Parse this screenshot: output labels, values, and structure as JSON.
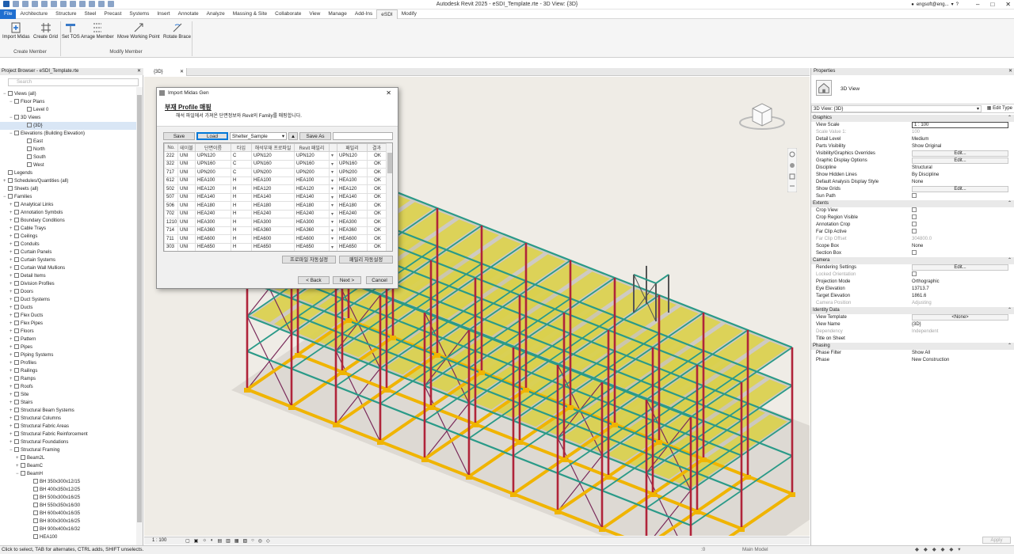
{
  "window": {
    "title": "Autodesk Revit 2025 - eSDI_Template.rte - 3D View: {3D}",
    "user": "engsoft@eng..."
  },
  "tabs": [
    "File",
    "Architecture",
    "Structure",
    "Steel",
    "Precast",
    "Systems",
    "Insert",
    "Annotate",
    "Analyze",
    "Massing & Site",
    "Collaborate",
    "View",
    "Manage",
    "Add-Ins",
    "eSDI",
    "Modify"
  ],
  "active_tab": "eSDI",
  "ribbon": {
    "buttons": [
      "Import Midas",
      "Create Grid",
      "Set TOS",
      "Arrage Member",
      "Move Working Point",
      "Rotate Brace"
    ],
    "panels": [
      "Create Member",
      "Modify Member"
    ]
  },
  "project_browser": {
    "title": "Project Browser - eSDI_Template.rte",
    "search_placeholder": "Search",
    "items": [
      {
        "label": "Views (all)",
        "depth": 0,
        "exp": "−"
      },
      {
        "label": "Floor Plans",
        "depth": 1,
        "exp": "−"
      },
      {
        "label": "Level 0",
        "depth": 3,
        "exp": ""
      },
      {
        "label": "3D Views",
        "depth": 1,
        "exp": "−"
      },
      {
        "label": "{3D}",
        "depth": 3,
        "exp": "",
        "sel": true
      },
      {
        "label": "Elevations (Building Elevation)",
        "depth": 1,
        "exp": "−"
      },
      {
        "label": "East",
        "depth": 3,
        "exp": ""
      },
      {
        "label": "North",
        "depth": 3,
        "exp": ""
      },
      {
        "label": "South",
        "depth": 3,
        "exp": ""
      },
      {
        "label": "West",
        "depth": 3,
        "exp": ""
      },
      {
        "label": "Legends",
        "depth": 0,
        "exp": ""
      },
      {
        "label": "Schedules/Quantities (all)",
        "depth": 0,
        "exp": "+"
      },
      {
        "label": "Sheets (all)",
        "depth": 0,
        "exp": ""
      },
      {
        "label": "Families",
        "depth": 0,
        "exp": "−"
      },
      {
        "label": "Analytical Links",
        "depth": 1,
        "exp": "+"
      },
      {
        "label": "Annotation Symbols",
        "depth": 1,
        "exp": "+"
      },
      {
        "label": "Boundary Conditions",
        "depth": 1,
        "exp": "+"
      },
      {
        "label": "Cable Trays",
        "depth": 1,
        "exp": "+"
      },
      {
        "label": "Ceilings",
        "depth": 1,
        "exp": "+"
      },
      {
        "label": "Conduits",
        "depth": 1,
        "exp": "+"
      },
      {
        "label": "Curtain Panels",
        "depth": 1,
        "exp": "+"
      },
      {
        "label": "Curtain Systems",
        "depth": 1,
        "exp": "+"
      },
      {
        "label": "Curtain Wall Mullions",
        "depth": 1,
        "exp": "+"
      },
      {
        "label": "Detail Items",
        "depth": 1,
        "exp": "+"
      },
      {
        "label": "Division Profiles",
        "depth": 1,
        "exp": "+"
      },
      {
        "label": "Doors",
        "depth": 1,
        "exp": "+"
      },
      {
        "label": "Duct Systems",
        "depth": 1,
        "exp": "+"
      },
      {
        "label": "Ducts",
        "depth": 1,
        "exp": "+"
      },
      {
        "label": "Flex Ducts",
        "depth": 1,
        "exp": "+"
      },
      {
        "label": "Flex Pipes",
        "depth": 1,
        "exp": "+"
      },
      {
        "label": "Floors",
        "depth": 1,
        "exp": "+"
      },
      {
        "label": "Pattern",
        "depth": 1,
        "exp": "+"
      },
      {
        "label": "Pipes",
        "depth": 1,
        "exp": "+"
      },
      {
        "label": "Piping Systems",
        "depth": 1,
        "exp": "+"
      },
      {
        "label": "Profiles",
        "depth": 1,
        "exp": "+"
      },
      {
        "label": "Railings",
        "depth": 1,
        "exp": "+"
      },
      {
        "label": "Ramps",
        "depth": 1,
        "exp": "+"
      },
      {
        "label": "Roofs",
        "depth": 1,
        "exp": "+"
      },
      {
        "label": "Site",
        "depth": 1,
        "exp": "+"
      },
      {
        "label": "Stairs",
        "depth": 1,
        "exp": "+"
      },
      {
        "label": "Structural Beam Systems",
        "depth": 1,
        "exp": "+"
      },
      {
        "label": "Structural Columns",
        "depth": 1,
        "exp": "+"
      },
      {
        "label": "Structural Fabric Areas",
        "depth": 1,
        "exp": "+"
      },
      {
        "label": "Structural Fabric Reinforcement",
        "depth": 1,
        "exp": "+"
      },
      {
        "label": "Structural Foundations",
        "depth": 1,
        "exp": "+"
      },
      {
        "label": "Structural Framing",
        "depth": 1,
        "exp": "−"
      },
      {
        "label": "Beam2L",
        "depth": 2,
        "exp": "+"
      },
      {
        "label": "BeamC",
        "depth": 2,
        "exp": "+"
      },
      {
        "label": "BeamH",
        "depth": 2,
        "exp": "−"
      },
      {
        "label": "BH 350x300x12/15",
        "depth": 4,
        "exp": ""
      },
      {
        "label": "BH 400x350x12/25",
        "depth": 4,
        "exp": ""
      },
      {
        "label": "BH 500x300x16/25",
        "depth": 4,
        "exp": ""
      },
      {
        "label": "BH 550x350x16/30",
        "depth": 4,
        "exp": ""
      },
      {
        "label": "BH 600x400x16/35",
        "depth": 4,
        "exp": ""
      },
      {
        "label": "BH 800x300x16/25",
        "depth": 4,
        "exp": ""
      },
      {
        "label": "BH 900x400x16/32",
        "depth": 4,
        "exp": ""
      },
      {
        "label": "HEA100",
        "depth": 4,
        "exp": ""
      }
    ]
  },
  "view_tab": {
    "label": "{3D}"
  },
  "view_control_bar": {
    "scale": "1 : 100"
  },
  "status": {
    "left": "Click to select, TAB for alternates, CTRL adds, SHIFT unselects.",
    "zero": ":0",
    "model": "Main Model"
  },
  "properties": {
    "title": "Properties",
    "type_name": "3D View",
    "instance": "3D View: {3D}",
    "edit_type": "Edit Type",
    "apply": "Apply",
    "groups": [
      {
        "name": "Graphics",
        "rows": [
          {
            "k": "View Scale",
            "v": "1 : 100",
            "kind": "select"
          },
          {
            "k": "Scale Value    1:",
            "v": "100",
            "kind": "dis"
          },
          {
            "k": "Detail Level",
            "v": "Medium"
          },
          {
            "k": "Parts Visibility",
            "v": "Show Original"
          },
          {
            "k": "Visibility/Graphics Overrides",
            "v": "Edit...",
            "kind": "edit"
          },
          {
            "k": "Graphic Display Options",
            "v": "Edit...",
            "kind": "edit"
          },
          {
            "k": "Discipline",
            "v": "Structural"
          },
          {
            "k": "Show Hidden Lines",
            "v": "By Discipline"
          },
          {
            "k": "Default Analysis Display Style",
            "v": "None"
          },
          {
            "k": "Show Grids",
            "v": "Edit...",
            "kind": "edit"
          },
          {
            "k": "Sun Path",
            "v": "",
            "kind": "cb"
          }
        ]
      },
      {
        "name": "Extents",
        "rows": [
          {
            "k": "Crop View",
            "v": "",
            "kind": "cb"
          },
          {
            "k": "Crop Region Visible",
            "v": "",
            "kind": "cb"
          },
          {
            "k": "Annotation Crop",
            "v": "",
            "kind": "cb"
          },
          {
            "k": "Far Clip Active",
            "v": "",
            "kind": "cb"
          },
          {
            "k": "Far Clip Offset",
            "v": "304800.0",
            "kind": "dis"
          },
          {
            "k": "Scope Box",
            "v": "None"
          },
          {
            "k": "Section Box",
            "v": "",
            "kind": "cb"
          }
        ]
      },
      {
        "name": "Camera",
        "rows": [
          {
            "k": "Rendering Settings",
            "v": "Edit...",
            "kind": "edit"
          },
          {
            "k": "Locked Orientation",
            "v": "",
            "kind": "discb"
          },
          {
            "k": "Projection Mode",
            "v": "Orthographic"
          },
          {
            "k": "Eye Elevation",
            "v": "13713.7"
          },
          {
            "k": "Target Elevation",
            "v": "1861.6"
          },
          {
            "k": "Camera Position",
            "v": "Adjusting",
            "kind": "dis"
          }
        ]
      },
      {
        "name": "Identity Data",
        "rows": [
          {
            "k": "View Template",
            "v": "<None>",
            "kind": "edit"
          },
          {
            "k": "View Name",
            "v": "{3D}"
          },
          {
            "k": "Dependency",
            "v": "Independent",
            "kind": "dis"
          },
          {
            "k": "Title on Sheet",
            "v": ""
          }
        ]
      },
      {
        "name": "Phasing",
        "rows": [
          {
            "k": "Phase Filter",
            "v": "Show All"
          },
          {
            "k": "Phase",
            "v": "New Construction"
          }
        ]
      }
    ]
  },
  "dialog": {
    "title": "Import Midas Gen",
    "heading": "부재 Profile 매핑",
    "subheading": "해석 파일에서 가져온 단면정보와 Revit의 Family를 매핑합니다.",
    "buttons": {
      "save": "Save",
      "load": "Load",
      "save_as": "Save As",
      "auto_profile": "프로파일 자동설정",
      "auto_family": "패밀리 자동설정",
      "back": "< Back",
      "next": "Next >",
      "cancel": "Cancel"
    },
    "file_select": "Shelter_Sample",
    "columns": [
      "No.",
      "테이블",
      "단면이름",
      "타입",
      "해석부재 프로파일",
      "Revit 패밀리",
      "",
      "패밀리",
      "결과"
    ],
    "rows": [
      [
        "222",
        "UNI",
        "UPN120",
        "C",
        "UPN120",
        "UPN120",
        "UPN120",
        "OK"
      ],
      [
        "322",
        "UNI",
        "UPN160",
        "C",
        "UPN160",
        "UPN160",
        "UPN160",
        "OK"
      ],
      [
        "717",
        "UNI",
        "UPN200",
        "C",
        "UPN200",
        "UPN200",
        "UPN200",
        "OK"
      ],
      [
        "612",
        "UNI",
        "HEA100",
        "H",
        "HEA100",
        "HEA100",
        "HEA100",
        "OK"
      ],
      [
        "502",
        "UNI",
        "HEA120",
        "H",
        "HEA120",
        "HEA120",
        "HEA120",
        "OK"
      ],
      [
        "507",
        "UNI",
        "HEA140",
        "H",
        "HEA140",
        "HEA140",
        "HEA140",
        "OK"
      ],
      [
        "506",
        "UNI",
        "HEA180",
        "H",
        "HEA180",
        "HEA180",
        "HEA180",
        "OK"
      ],
      [
        "702",
        "UNI",
        "HEA240",
        "H",
        "HEA240",
        "HEA240",
        "HEA240",
        "OK"
      ],
      [
        "1210",
        "UNI",
        "HEA300",
        "H",
        "HEA300",
        "HEA300",
        "HEA300",
        "OK"
      ],
      [
        "714",
        "UNI",
        "HEA360",
        "H",
        "HEA360",
        "HEA360",
        "HEA360",
        "OK"
      ],
      [
        "711",
        "UNI",
        "HEA600",
        "H",
        "HEA600",
        "HEA600",
        "HEA600",
        "OK"
      ],
      [
        "303",
        "UNI",
        "HEA650",
        "H",
        "HEA650",
        "HEA650",
        "HEA650",
        "OK"
      ]
    ]
  },
  "colors": {
    "ribbon_bg": "#f5f5f5",
    "file_tab": "#1f6fd0",
    "viewport_bg": "#efece6",
    "column": "#b0243a",
    "beam": "#2a9a88",
    "deck": "#e8d800",
    "base": "#f0b400",
    "brace": "#7a2a5a"
  }
}
